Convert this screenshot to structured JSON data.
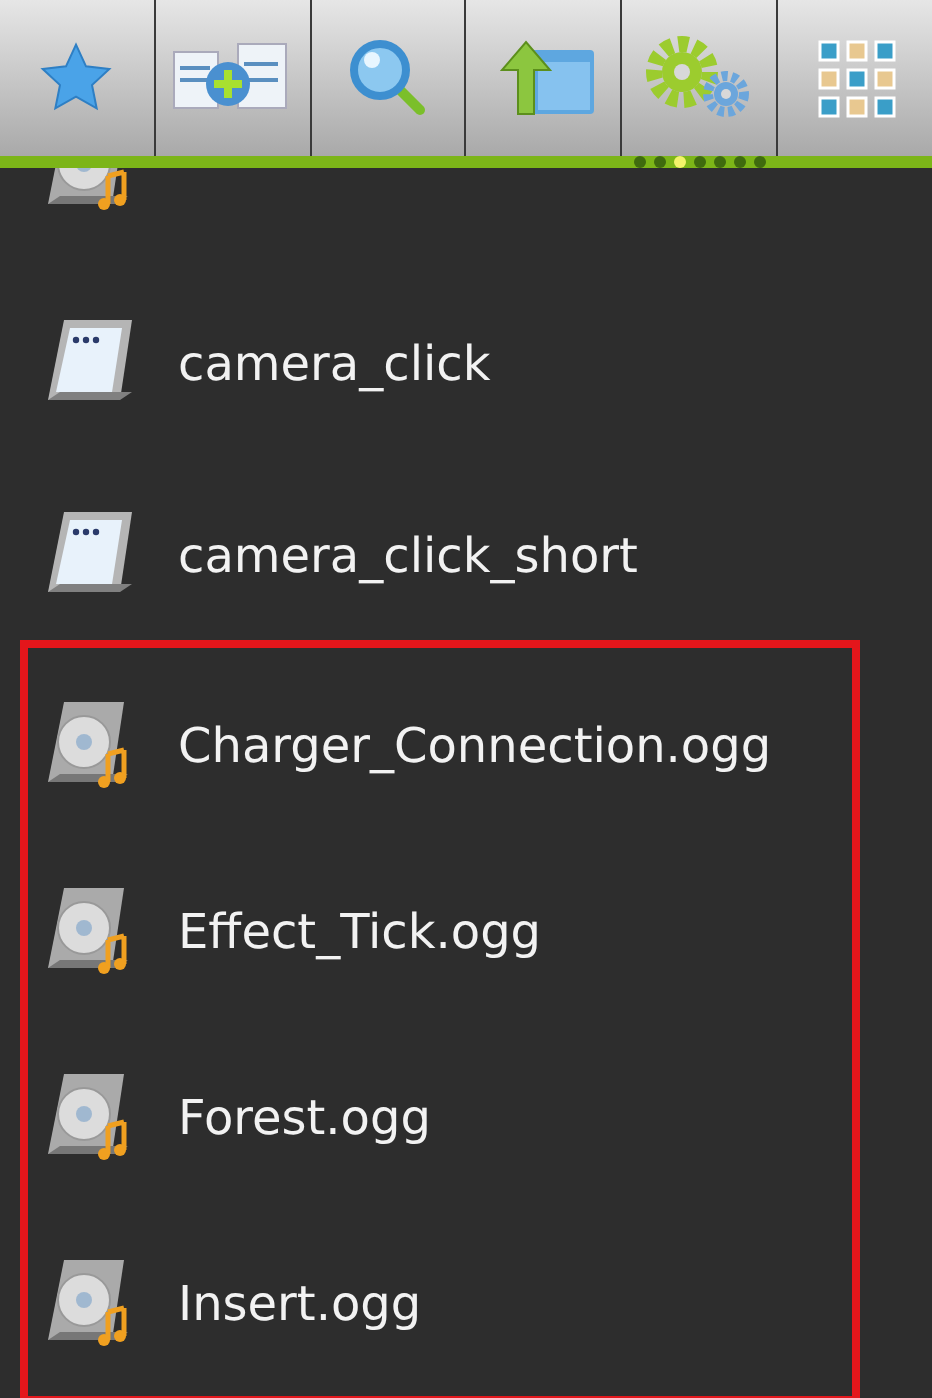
{
  "toolbar": {
    "buttons": [
      {
        "kind": "star"
      },
      {
        "kind": "add"
      },
      {
        "kind": "search"
      },
      {
        "kind": "up"
      },
      {
        "kind": "settings"
      },
      {
        "kind": "grid"
      }
    ]
  },
  "page_indicator": {
    "dots": [
      {
        "selected": false
      },
      {
        "selected": false
      },
      {
        "selected": true
      },
      {
        "selected": false
      },
      {
        "selected": false
      },
      {
        "selected": false
      },
      {
        "selected": false
      }
    ]
  },
  "files": [
    {
      "kind": "audio",
      "partial": true,
      "highlighted": false
    },
    {
      "kind": "unknown",
      "name": "camera_click",
      "partial": false,
      "highlighted": false
    },
    {
      "kind": "unknown",
      "name": "camera_click_short",
      "partial": false,
      "highlighted": false
    },
    {
      "kind": "audio",
      "name": "Charger_Connection.ogg",
      "partial": false,
      "highlighted": true
    },
    {
      "kind": "audio",
      "name": "Effect_Tick.ogg",
      "partial": false,
      "highlighted": true
    },
    {
      "kind": "audio",
      "name": "Forest.ogg",
      "partial": false,
      "highlighted": true
    },
    {
      "kind": "audio",
      "name": "Insert.ogg",
      "partial": false,
      "highlighted": true
    }
  ]
}
